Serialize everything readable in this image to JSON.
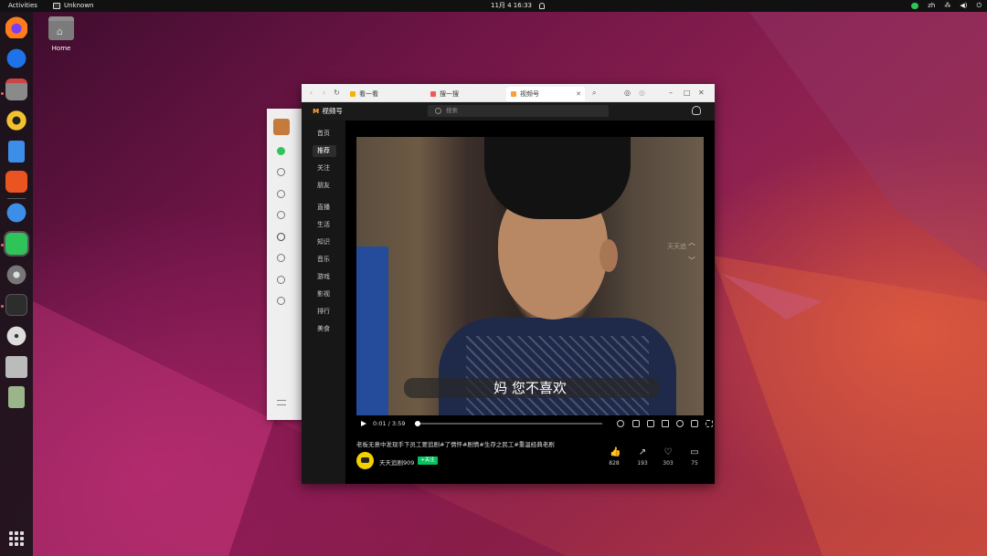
{
  "topbar": {
    "activities": "Activities",
    "app_name": "Unknown",
    "datetime": "11月 4 16:33",
    "input_method": "zh"
  },
  "desktop": {
    "home_label": "Home"
  },
  "browser": {
    "tabs": [
      {
        "label": "看一看",
        "icon": "star-icon",
        "color": "#f5b400"
      },
      {
        "label": "搜一搜",
        "icon": "search-tab-icon",
        "color": "#f25a5a"
      },
      {
        "label": "视频号",
        "icon": "channels-icon",
        "color": "#fa9d3b",
        "active": true
      }
    ],
    "channel_title": "视频号",
    "search_placeholder": "搜索",
    "nav_items": [
      "首页",
      "推荐",
      "关注",
      "朋友",
      "直播",
      "生活",
      "知识",
      "音乐",
      "游戏",
      "影视",
      "排行",
      "美食"
    ],
    "selected_nav": "推荐",
    "video": {
      "subtitle": "妈 您不喜欢",
      "watermark": "天天追",
      "time": "0:01 / 3:59",
      "progress": 0.004,
      "caption": "老板无意中发现手下员工要追剧#了情怀#剧情#生存之民工#重温经典老剧",
      "author": "天天追剧909",
      "follow": "+关注",
      "stats": [
        {
          "name": "like",
          "icon": "thumb-up-icon",
          "glyph": "👍",
          "count": "828"
        },
        {
          "name": "share",
          "icon": "share-icon",
          "glyph": "↗",
          "count": "193"
        },
        {
          "name": "favorite",
          "icon": "heart-icon",
          "glyph": "♡",
          "count": "303"
        },
        {
          "name": "comment",
          "icon": "comment-icon",
          "glyph": "▭",
          "count": "75"
        }
      ]
    }
  }
}
